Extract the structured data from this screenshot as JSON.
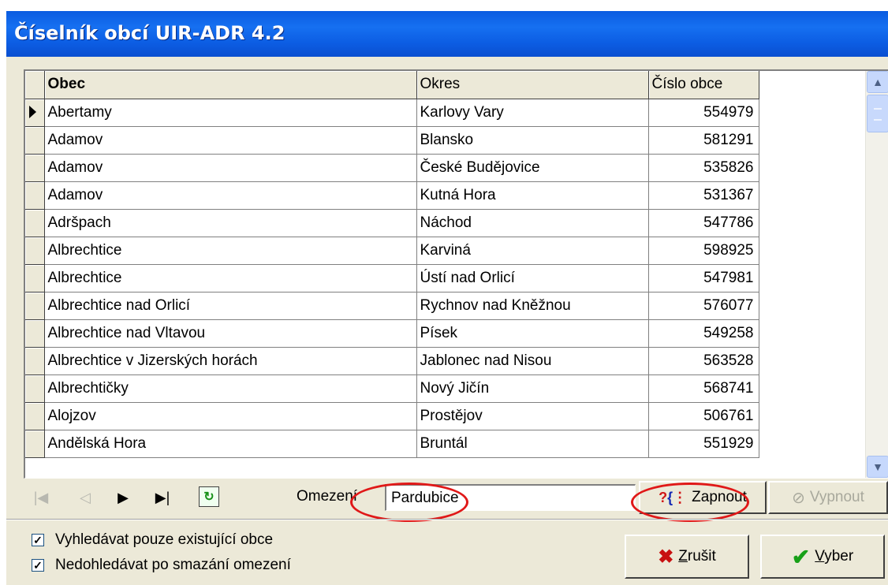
{
  "window": {
    "title": "Číselník obcí UIR-ADR 4.2"
  },
  "grid": {
    "columns": [
      "Obec",
      "Okres",
      "Číslo obce"
    ],
    "rows": [
      {
        "obec": "Abertamy",
        "okres": "Karlovy Vary",
        "cislo": "554979"
      },
      {
        "obec": "Adamov",
        "okres": "Blansko",
        "cislo": "581291"
      },
      {
        "obec": "Adamov",
        "okres": "České Budějovice",
        "cislo": "535826"
      },
      {
        "obec": "Adamov",
        "okres": "Kutná Hora",
        "cislo": "531367"
      },
      {
        "obec": "Adršpach",
        "okres": "Náchod",
        "cislo": "547786"
      },
      {
        "obec": "Albrechtice",
        "okres": "Karviná",
        "cislo": "598925"
      },
      {
        "obec": "Albrechtice",
        "okres": "Ústí nad Orlicí",
        "cislo": "547981"
      },
      {
        "obec": "Albrechtice nad Orlicí",
        "okres": "Rychnov nad Kněžnou",
        "cislo": "576077"
      },
      {
        "obec": "Albrechtice nad Vltavou",
        "okres": "Písek",
        "cislo": "549258"
      },
      {
        "obec": "Albrechtice v Jizerských horách",
        "okres": "Jablonec nad Nisou",
        "cislo": "563528"
      },
      {
        "obec": "Albrechtičky",
        "okres": "Nový Jičín",
        "cislo": "568741"
      },
      {
        "obec": "Alojzov",
        "okres": "Prostějov",
        "cislo": "506761"
      },
      {
        "obec": "Andělská Hora",
        "okres": "Bruntál",
        "cislo": "551929"
      }
    ]
  },
  "filter": {
    "label": "Omezení",
    "value": "Pardubice",
    "on_label": "Zapnout",
    "off_label": "Vypnout"
  },
  "options": {
    "only_existing": "Vyhledávat pouze existující obce",
    "no_search_after_clear": "Nedohledávat po smazání omezení"
  },
  "actions": {
    "cancel_label": "Zrušit",
    "select_label": "Vyber"
  },
  "icons": [
    "first-record-icon",
    "prior-record-icon",
    "next-record-icon",
    "last-record-icon",
    "refresh-icon",
    "help-filter-icon",
    "disabled-circle-icon",
    "red-x-icon",
    "green-check-icon"
  ],
  "colors": {
    "titlebar": "#0a5be0",
    "highlight": "#e01818",
    "face": "#ece9d8"
  }
}
